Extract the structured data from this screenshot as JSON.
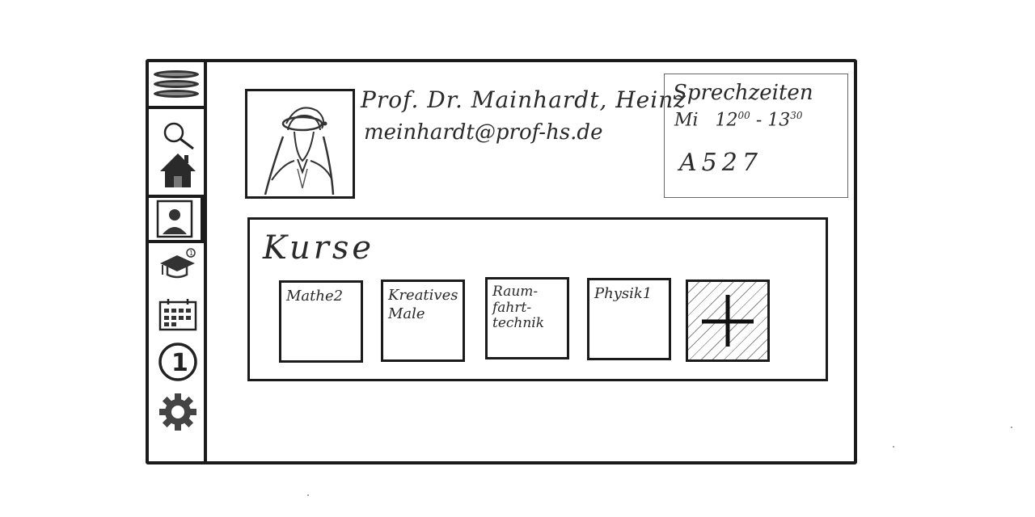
{
  "sidebar": {
    "items": [
      {
        "icon": "menu-icon"
      },
      {
        "icon": "search-icon"
      },
      {
        "icon": "home-icon"
      },
      {
        "icon": "profile-icon",
        "active": true
      },
      {
        "icon": "graduation-cap-icon"
      },
      {
        "icon": "calendar-icon"
      },
      {
        "icon": "number-badge-icon",
        "label": "1"
      },
      {
        "icon": "gear-icon"
      }
    ]
  },
  "profile": {
    "name": "Prof. Dr. Mainhardt, Heinz",
    "email": "meinhardt@prof-hs.de"
  },
  "office_hours": {
    "title": "Sprechzeiten",
    "day": "Mi",
    "start": "12",
    "start_min": "00",
    "dash": "-",
    "end": "13",
    "end_min": "30",
    "room": "A527"
  },
  "courses": {
    "title": "Kurse",
    "items": [
      {
        "label": "Mathe2"
      },
      {
        "label": "Kreatives\n Male"
      },
      {
        "label": "Raum-\nfahrt-\ntechnik"
      },
      {
        "label": "Physik1"
      }
    ],
    "add_icon": "plus-icon"
  },
  "colors": {
    "stroke": "#1b1b1b",
    "hatch": "#8a8a8a",
    "background": "#ffffff"
  }
}
